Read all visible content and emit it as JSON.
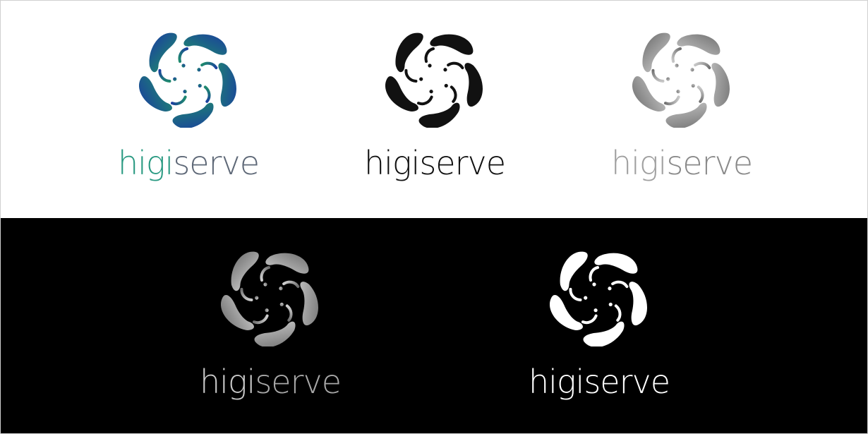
{
  "brand": {
    "wordmark_part1": "higi",
    "wordmark_part2": "serve"
  },
  "variants": [
    {
      "id": "color",
      "background": "white",
      "mark_gradient": [
        "#1f8a6e",
        "#1a3f9e"
      ],
      "word1": "#2a9a82",
      "word2": "#5e6877"
    },
    {
      "id": "black",
      "background": "white",
      "mark_gradient": [
        "#111111",
        "#111111"
      ],
      "word1": "#111111",
      "word2": "#111111"
    },
    {
      "id": "gray",
      "background": "white",
      "mark_gradient": [
        "#c8c8c8",
        "#707070"
      ],
      "word1": "#a0a0a0",
      "word2": "#8a8a8a"
    },
    {
      "id": "gray-on-black",
      "background": "black",
      "mark_gradient": [
        "#cfcfcf",
        "#6e6e6e"
      ],
      "word1": "#c8c8c8",
      "word2": "#a8a8a8"
    },
    {
      "id": "white-on-black",
      "background": "black",
      "mark_gradient": [
        "#ffffff",
        "#ffffff"
      ],
      "word1": "#ffffff",
      "word2": "#ffffff"
    }
  ]
}
